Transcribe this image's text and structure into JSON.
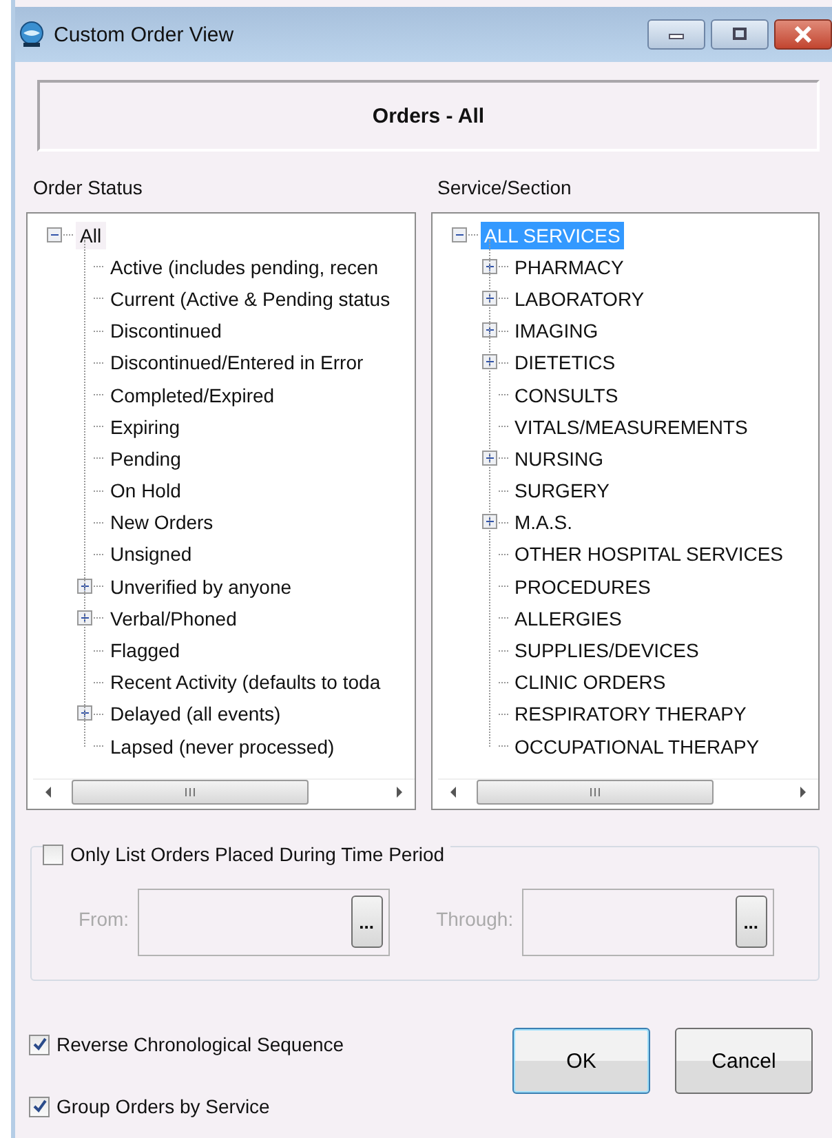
{
  "window": {
    "title": "Custom Order View"
  },
  "header": "Orders - All",
  "order_status": {
    "label": "Order Status",
    "root": {
      "label": "All",
      "expanded": true,
      "selected": false,
      "children": [
        {
          "label": "Active (includes pending, recen",
          "kind": "leaf",
          "selected": false
        },
        {
          "label": "Current (Active & Pending status",
          "kind": "leaf",
          "selected": false
        },
        {
          "label": "Discontinued",
          "kind": "leaf",
          "selected": false
        },
        {
          "label": "Discontinued/Entered in Error",
          "kind": "leaf",
          "selected": false
        },
        {
          "label": "Completed/Expired",
          "kind": "leaf",
          "selected": false
        },
        {
          "label": "Expiring",
          "kind": "leaf",
          "selected": false
        },
        {
          "label": "Pending",
          "kind": "leaf",
          "selected": false
        },
        {
          "label": "On Hold",
          "kind": "leaf",
          "selected": false
        },
        {
          "label": "New Orders",
          "kind": "leaf",
          "selected": false
        },
        {
          "label": "Unsigned",
          "kind": "leaf",
          "selected": false
        },
        {
          "label": "Unverified by anyone",
          "kind": "branch",
          "expanded": false,
          "selected": false
        },
        {
          "label": "Verbal/Phoned",
          "kind": "branch",
          "expanded": false,
          "selected": false
        },
        {
          "label": "Flagged",
          "kind": "leaf",
          "selected": false
        },
        {
          "label": "Recent Activity (defaults to toda",
          "kind": "leaf",
          "selected": false
        },
        {
          "label": "Delayed (all events)",
          "kind": "branch",
          "expanded": false,
          "selected": false
        },
        {
          "label": "Lapsed (never processed)",
          "kind": "leaf",
          "selected": false
        }
      ]
    }
  },
  "service_section": {
    "label": "Service/Section",
    "root": {
      "label": "ALL SERVICES",
      "expanded": true,
      "selected": true,
      "children": [
        {
          "label": "PHARMACY",
          "kind": "branch",
          "expanded": false,
          "selected": false
        },
        {
          "label": "LABORATORY",
          "kind": "branch",
          "expanded": false,
          "selected": false
        },
        {
          "label": "IMAGING",
          "kind": "branch",
          "expanded": false,
          "selected": false
        },
        {
          "label": "DIETETICS",
          "kind": "branch",
          "expanded": false,
          "selected": false
        },
        {
          "label": "CONSULTS",
          "kind": "leaf",
          "selected": false
        },
        {
          "label": "VITALS/MEASUREMENTS",
          "kind": "leaf",
          "selected": false
        },
        {
          "label": "NURSING",
          "kind": "branch",
          "expanded": false,
          "selected": false
        },
        {
          "label": "SURGERY",
          "kind": "leaf",
          "selected": false
        },
        {
          "label": "M.A.S.",
          "kind": "branch",
          "expanded": false,
          "selected": false
        },
        {
          "label": "OTHER HOSPITAL SERVICES",
          "kind": "leaf",
          "selected": false
        },
        {
          "label": "PROCEDURES",
          "kind": "leaf",
          "selected": false
        },
        {
          "label": "ALLERGIES",
          "kind": "leaf",
          "selected": false
        },
        {
          "label": "SUPPLIES/DEVICES",
          "kind": "leaf",
          "selected": false
        },
        {
          "label": "CLINIC ORDERS",
          "kind": "leaf",
          "selected": false
        },
        {
          "label": "RESPIRATORY THERAPY",
          "kind": "leaf",
          "selected": false
        },
        {
          "label": "OCCUPATIONAL THERAPY",
          "kind": "leaf",
          "selected": false
        }
      ]
    }
  },
  "time_period": {
    "label": "Only List Orders Placed During Time Period",
    "checked": false,
    "from_label": "From:",
    "through_label": "Through:",
    "browse_button": "...",
    "disabled": true
  },
  "options": [
    {
      "label": "Reverse Chronological Sequence",
      "checked": true
    },
    {
      "label": "Group Orders by Service",
      "checked": true
    }
  ],
  "buttons": [
    {
      "label": "OK",
      "default": true
    },
    {
      "label": "Cancel",
      "default": false
    }
  ]
}
